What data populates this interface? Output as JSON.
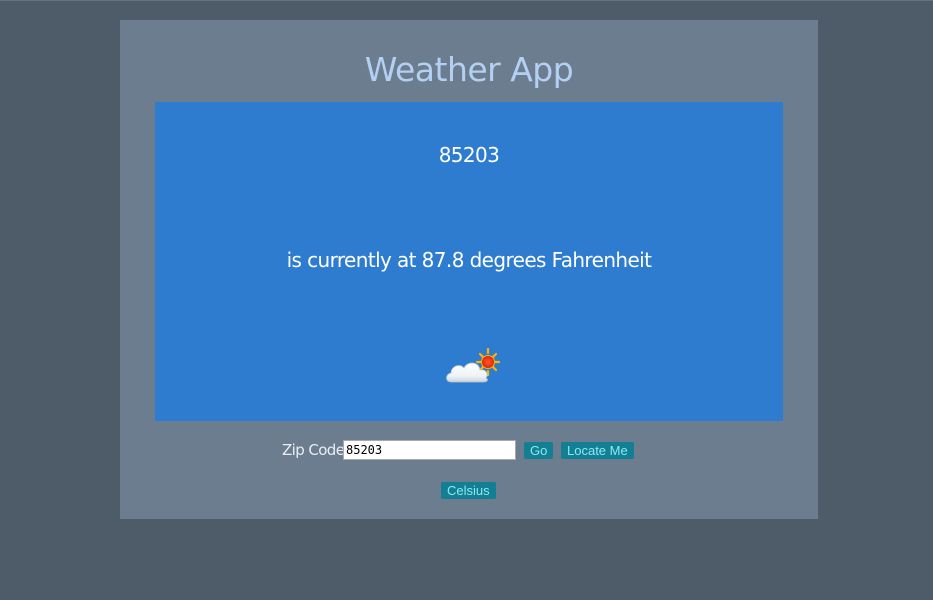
{
  "app": {
    "title": "Weather App"
  },
  "weather": {
    "zip": "85203",
    "description": "is currently at 87.8 degrees Fahrenheit",
    "icon": "partly-cloudy-sun-icon"
  },
  "form": {
    "zip_label": "Zip Code",
    "zip_value": "85203",
    "go_label": "Go",
    "locate_label": "Locate Me",
    "celsius_label": "Celsius"
  },
  "colors": {
    "page_background": "#4e5b69",
    "app_background": "#6c7d8f",
    "panel_background": "#2e7ccf",
    "title_color": "#b3d0f2",
    "button_background": "#127f92",
    "button_text": "#8fe7f3"
  }
}
